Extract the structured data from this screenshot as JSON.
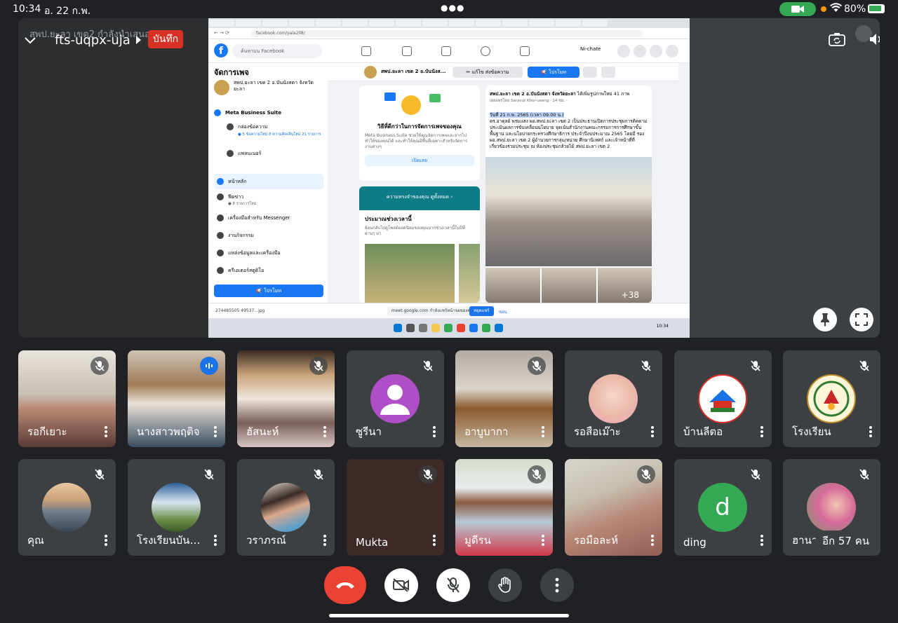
{
  "status_bar": {
    "time": "10:34",
    "date": "อ. 22 ก.พ.",
    "battery": "80%",
    "colors": {
      "camera_pill": "#34a853",
      "indicator": "#f29900"
    }
  },
  "meeting": {
    "presenter_text": "สพป.ยะลา เขต2 กำลังนำเสนอ",
    "code": "fts-uqpx-uja",
    "record_label": "บันทึก",
    "record_color": "#d93025"
  },
  "shared_screen": {
    "url": "facebook.com/yala2ll8/",
    "fb_search_placeholder": "ค้นหาบน Facebook",
    "fb_user": "Ni-chate",
    "sidebar": {
      "title": "จัดการเพจ",
      "page_name": "สพป.ยะลา เขต 2 อ.บันนังสตา จังหวัดยะลา",
      "meta_suite": "Meta Business Suite",
      "inbox": "กล่องข้อความ",
      "inbox_sub": "● 5 ข้อความใหม่ 8 ความคิดเห็นใหม่ 21 รายการ",
      "planner": "แพลนเนอร์",
      "home": "หน้าหลัก",
      "news": "ฟีดข่าว",
      "news_sub": "● 8 รายการใหม่",
      "messenger": "เครื่องมือสำหรับ Messenger",
      "events": "งานกิจกรรม",
      "resources": "แหล่งข้อมูลและเครื่องมือ",
      "creator": "ครีเอเตอร์สตูดิโอ",
      "promote": "📢 โปรโมท"
    },
    "pagebar": {
      "title": "สพป.ยะลา เขต 2 อ.บันนังส...",
      "edit": "✏ แก้ไข ส่งข้อความ",
      "promote": "📢 โปรโมท"
    },
    "card1": {
      "title": "วิธีที่ดีกว่าในการจัดการเพจของคุณ",
      "desc": "Meta Business Suite ช่วยให้คุณจัดการเพจและจากไปทำให้ของคุณได้ และทำให้คุณมีพื้นที่เฉพาะสำหรับจัดการงานต่างๆ",
      "open": "เปิดเลย"
    },
    "card2": {
      "banner": "ความทรงจำของคุณ",
      "banner_sub": "ดูทั้งหมด ›",
      "title": "ประมาณช่วงเวลานี้",
      "desc": "ย้อนกลับไปดูโพสต์ยอดนิยมของคุณจากช่วงเวลานี้ในปีที่ผ่านๆ มา"
    },
    "post": {
      "page": "สพป.ยะลา เขต 2 อ.บันนังสตา จังหวัดยะลา",
      "action": "ได้เพิ่มรูปภาพใหม่ 41 ภาพ",
      "by": "เผยแพร่โดย Saravut Khor-useng · 14 ชม. ·",
      "date_line": "วันที่ 21 ก.พ. 2565 (เวลา 09.00 น.)",
      "body": "ดร.อาดุลย์ พรมแสง ผอ.สพป.ยะลา เขต 2 เป็นประธานเปิดการประชุมการติดตามประเมินผลการขับเคลื่อนนโยบาย จุดเน้นสำนักงานคณะกรรมการการศึกษาขั้นพื้นฐาน และนโยบายกระทรวงศึกษาธิการ ประจำปีงบประมาณ 2565 โดยมี รอง ผอ.สพป.ยะลา เขต 2 ผู้อำนวยการกลุ่ม/หน่วย ศึกษานิเทศก์ และเจ้าหน้าที่ที่เกี่ยวข้องร่วมประชุม ณ ห้องประชุมกล้วยไม้ สพป.ยะลา เขต 2",
      "more_photos": "+38"
    },
    "download_file": "274485505 49537...jpg",
    "share_notice": "meet.google.com กำลังแชร์หน้าจอของคุณ",
    "share_stop": "หยุดแชร์",
    "share_hide": "ซ่อน",
    "taskbar_time": "10:34"
  },
  "participants": [
    {
      "name": "รอกีเยาะ",
      "muted": true
    },
    {
      "name": "นางสาวพฤติจ",
      "muted": false,
      "speaking": true
    },
    {
      "name": "ฮัสนะห์",
      "muted": true
    },
    {
      "name": "ซูรีนา",
      "muted": true
    },
    {
      "name": "อาบูบากา",
      "muted": true
    },
    {
      "name": "รอสือเม๊าะ",
      "muted": true
    },
    {
      "name": "บ้านลีตอ",
      "muted": true
    },
    {
      "name": "โรงเรียน",
      "muted": true
    },
    {
      "name": "คุณ",
      "muted": true
    },
    {
      "name": "โรงเรียนบัน…",
      "muted": true
    },
    {
      "name": "วราภรณ์",
      "muted": true
    },
    {
      "name": "Mukta",
      "muted": true
    },
    {
      "name": "มูดีรน",
      "muted": true
    },
    {
      "name": "รอมือละห์",
      "muted": true
    },
    {
      "name": "ding",
      "muted": true,
      "initial": "d",
      "avatar_color": "#34a853"
    },
    {
      "name": "ฮานา",
      "muted": true
    }
  ],
  "more_participants": "อีก 57 คน",
  "controls": {
    "end_call_color": "#ea4335",
    "icons": [
      "end-call-icon",
      "camera-off-icon",
      "mic-off-icon",
      "raise-hand-icon",
      "more-options-icon"
    ]
  }
}
